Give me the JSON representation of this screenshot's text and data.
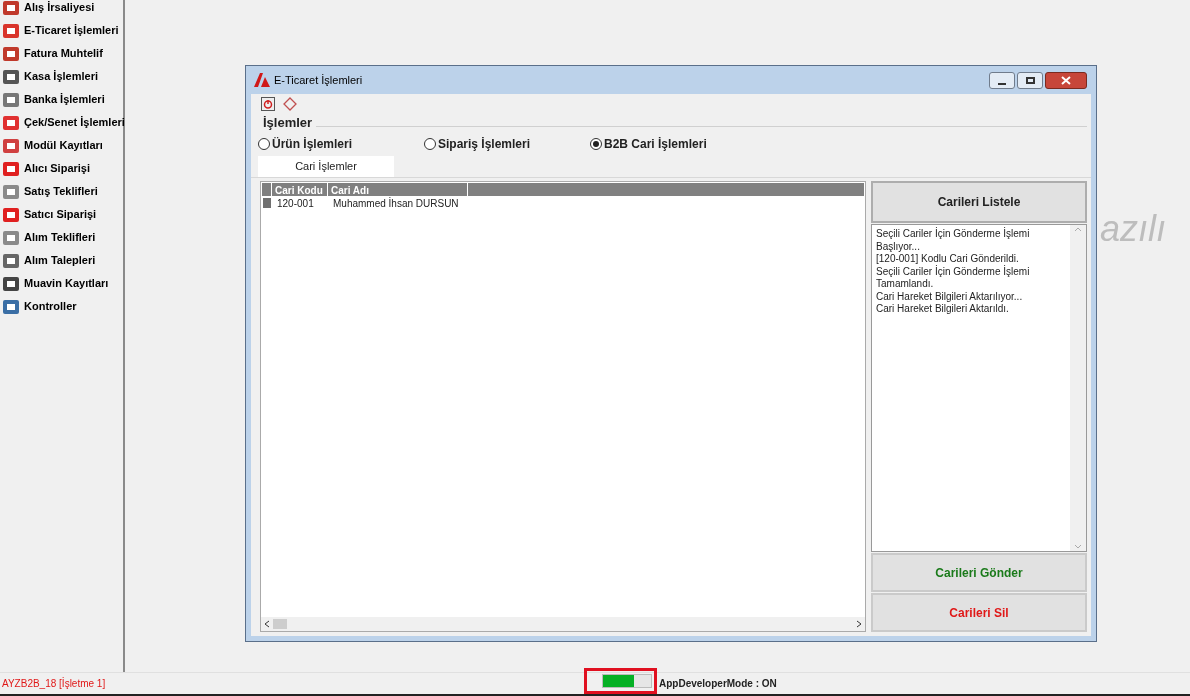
{
  "sidebar": {
    "items": [
      {
        "label": "Alış İrsaliyesi",
        "color": "#c0392b"
      },
      {
        "label": "E-Ticaret İşlemleri",
        "color": "#d9342b"
      },
      {
        "label": "Fatura Muhtelif",
        "color": "#c0392b"
      },
      {
        "label": "Kasa İşlemleri",
        "color": "#555555"
      },
      {
        "label": "Banka İşlemleri",
        "color": "#777777"
      },
      {
        "label": "Çek/Senet İşlemleri",
        "color": "#e03030"
      },
      {
        "label": "Modül Kayıtları",
        "color": "#d04040"
      },
      {
        "label": "Alıcı Siparişi",
        "color": "#e02020"
      },
      {
        "label": "Satış Teklifleri",
        "color": "#8a8a8a"
      },
      {
        "label": "Satıcı Siparişi",
        "color": "#e02020"
      },
      {
        "label": "Alım Teklifleri",
        "color": "#8a8a8a"
      },
      {
        "label": "Alım Talepleri",
        "color": "#666666"
      },
      {
        "label": "Muavin Kayıtları",
        "color": "#444444"
      },
      {
        "label": "Kontroller",
        "color": "#3a6ea5"
      }
    ]
  },
  "background_text": "azılı",
  "window": {
    "title": "E-Ticaret İşlemleri",
    "group_label": "İşlemler",
    "radios": [
      {
        "label": "Ürün İşlemleri",
        "selected": false
      },
      {
        "label": "Sipariş İşlemleri",
        "selected": false
      },
      {
        "label": "B2B Cari İşlemleri",
        "selected": true
      }
    ],
    "tabs": [
      {
        "label": "Cari İşlemler",
        "selected": true
      }
    ],
    "table": {
      "columns": [
        "Cari Kodu",
        "Cari Adı"
      ],
      "rows": [
        [
          "120-001",
          "Muhammed İhsan DURSUN"
        ]
      ]
    },
    "list_button": "Carileri Listele",
    "log": [
      "Seçili Cariler İçin Gönderme İşlemi Başlıyor...",
      "[120-001] Kodlu Cari Gönderildi.",
      "Seçili Cariler İçin Gönderme İşlemi Tamamlandı.",
      "Cari Hareket Bilgileri Aktarılıyor...",
      "Cari Hareket Bilgileri Aktarıldı."
    ],
    "send_button": "Carileri Gönder",
    "delete_button": "Carileri Sil"
  },
  "status_bar": {
    "company": "AYZB2B_18 [İşletme 1]",
    "progress": {
      "level": 0.65,
      "highlighted": true
    },
    "mode": "AppDeveloperMode : ON"
  }
}
